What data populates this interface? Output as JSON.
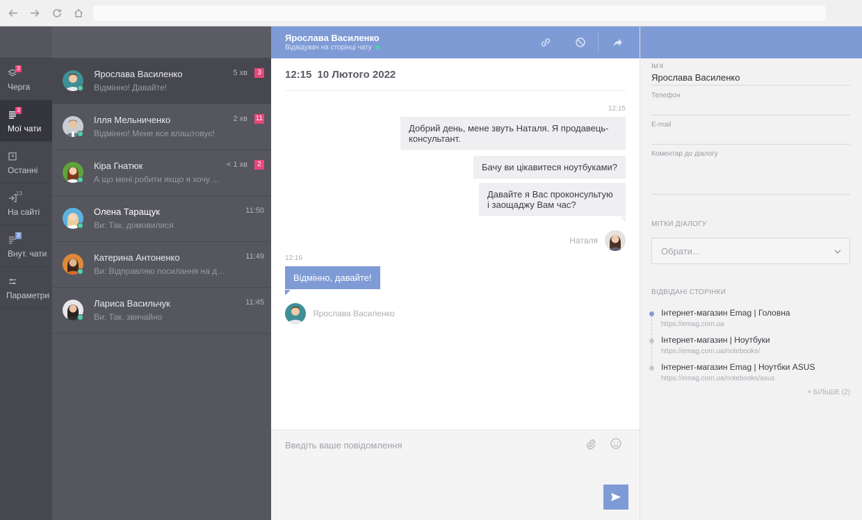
{
  "browser": {
    "url": ""
  },
  "nav": {
    "items": [
      {
        "label": "Черга",
        "badge": "3"
      },
      {
        "label": "Мої чати",
        "badge": "3"
      },
      {
        "label": "Останні",
        "badge": ""
      },
      {
        "label": "На сайті",
        "badge": "13"
      },
      {
        "label": "Внут. чати",
        "badge": "3"
      },
      {
        "label": "Параметри",
        "badge": ""
      }
    ]
  },
  "conversations": [
    {
      "name": "Ярослава Василенко",
      "preview": "Відмінно! Давайте!",
      "time": "5 хв",
      "count": "3"
    },
    {
      "name": "Ілля Мельниченко",
      "preview": "Відмінно! Мене все влаштовує!",
      "time": "2 хв",
      "count": "11"
    },
    {
      "name": "Кіра Гнатюк",
      "preview": "А що мені робити якщо я хочу ...",
      "time": "< 1 хв",
      "count": "2"
    },
    {
      "name": "Олена Таращук",
      "preview": "Ви: Так, домовилися",
      "time": "11:50",
      "count": ""
    },
    {
      "name": "Катерина Антоненко",
      "preview": "Ви: Відправляю посилання на дж ...",
      "time": "11:49",
      "count": ""
    },
    {
      "name": "Лариса Васильчук",
      "preview": "Ви: Так, звичайно",
      "time": "11:45",
      "count": ""
    }
  ],
  "chat": {
    "header_name": "Ярослава Василенко",
    "header_status": "Відвідувач на сторінці чату",
    "date_time": "12:15",
    "date_day": "10 Лютого 2022",
    "out_time": "12:15",
    "out_messages": [
      "Добрий день, мене звуть Наталя. Я продавець-консультант.",
      "Бачу ви цікавитеся ноутбуками?",
      "Давайте я Вас проконсультую і заощаджу Вам час?"
    ],
    "out_sender": "Наталя",
    "in_time": "12:16",
    "in_message": "Відмінно, давайте!",
    "in_sender": "Ярослава Василенко",
    "input_placeholder": "Введіть ваше повідомлення"
  },
  "details": {
    "name_label": "Ім'я",
    "name_value": "Ярослава Василенко",
    "phone_label": "Телефон",
    "phone_value": "",
    "email_label": "E-mail",
    "email_value": "",
    "comment_label": "Коментар до діалогу",
    "tags_title": "МІТКИ ДІАЛОГУ",
    "tags_placeholder": "Обрати...",
    "visited_title": "ВІДВІДАНІ СТОРІНКИ",
    "visited": [
      {
        "title": "Інтернет-магазин Emag | Головна",
        "url": "https://emag.com.ua"
      },
      {
        "title": "Інтернет-магазин | Ноутбуки",
        "url": "https://emag.com.ua/notebooks/"
      },
      {
        "title": "Інтернет-магазин Emag | Ноутбки ASUS",
        "url": "https://emag.com.ua/notebooks/asus"
      }
    ],
    "more": "+ БІЛЬШЕ (2)"
  },
  "colors": {
    "accent": "#7f9bd6",
    "badge": "#e8467a",
    "online": "#4fd1a8"
  }
}
